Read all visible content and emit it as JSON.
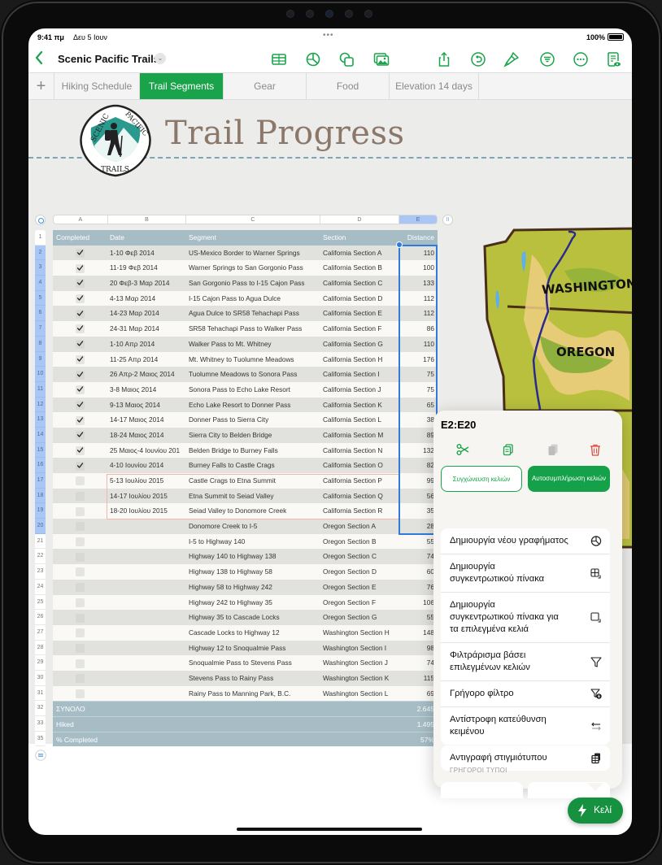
{
  "status_bar": {
    "time": "9:41 πμ",
    "date": "Δευ 5 Ιουν",
    "battery": "100%",
    "battery_level": 1.0
  },
  "toolbar": {
    "back_icon": "chevron-left-icon",
    "document_title": "Scenic Pacific Trails",
    "title_menu_icon": "chevron-down-icon",
    "icons": [
      "table-icon",
      "chart-icon",
      "shapes-icon",
      "media-icon",
      "share-icon",
      "undo-icon",
      "format-brush-icon",
      "organize-icon",
      "more-icon",
      "reader-view-icon"
    ]
  },
  "tabs": {
    "add_icon": "plus-icon",
    "items": [
      {
        "label": "Hiking Schedule",
        "active": false
      },
      {
        "label": "Trail Segments",
        "active": true
      },
      {
        "label": "Gear",
        "active": false
      },
      {
        "label": "Food",
        "active": false
      },
      {
        "label": "Elevation 14 days",
        "active": false
      }
    ]
  },
  "sheet": {
    "title": "Trail Progress",
    "logo": {
      "top_text_left": "SCENIC",
      "top_text_right": "PACIFIC",
      "bottom_text": "TRAILS"
    },
    "column_letters": [
      "A",
      "B",
      "C",
      "D",
      "E"
    ],
    "selected_column": "E",
    "row_numbers": [
      "1",
      "2",
      "3",
      "4",
      "5",
      "6",
      "7",
      "8",
      "9",
      "10",
      "11",
      "12",
      "13",
      "14",
      "15",
      "16",
      "17",
      "18",
      "19",
      "20",
      "21",
      "22",
      "23",
      "24",
      "25",
      "26",
      "27",
      "28",
      "29",
      "30",
      "31",
      "32",
      "33",
      "35"
    ],
    "selected_rows": "2-20",
    "table": {
      "headers": [
        "Completed",
        "Date",
        "Segment",
        "Section",
        "Distance"
      ],
      "rows": [
        {
          "completed": true,
          "date": "1-10 Φεβ 2014",
          "segment": "US-Mexico Border to Warner Springs",
          "section": "California Section A",
          "distance": "110"
        },
        {
          "completed": true,
          "date": "11-19 Φεβ 2014",
          "segment": "Warner Springs to San Gorgonio Pass",
          "section": "California Section B",
          "distance": "100"
        },
        {
          "completed": true,
          "date": "20 Φεβ-3 Μαρ 2014",
          "segment": "San Gorgonio Pass to I-15 Cajon Pass",
          "section": "California Section C",
          "distance": "133"
        },
        {
          "completed": true,
          "date": "4-13 Μαρ 2014",
          "segment": "I-15 Cajon Pass to Agua Dulce",
          "section": "California Section D",
          "distance": "112"
        },
        {
          "completed": true,
          "date": "14-23 Μαρ 2014",
          "segment": "Agua Dulce to SR58 Tehachapi Pass",
          "section": "California Section E",
          "distance": "112"
        },
        {
          "completed": true,
          "date": "24-31 Μαρ 2014",
          "segment": "SR58 Tehachapi Pass to Walker Pass",
          "section": "California Section F",
          "distance": "86"
        },
        {
          "completed": true,
          "date": "1-10 Απρ 2014",
          "segment": "Walker Pass to Mt. Whitney",
          "section": "California Section G",
          "distance": "110"
        },
        {
          "completed": true,
          "date": "11-25 Απρ 2014",
          "segment": "Mt. Whitney to Tuolumne Meadows",
          "section": "California Section H",
          "distance": "176"
        },
        {
          "completed": true,
          "date": "26 Απρ-2 Μαιος 2014",
          "segment": "Tuolumne Meadows to Sonora Pass",
          "section": "California Section I",
          "distance": "75"
        },
        {
          "completed": true,
          "date": "3-8 Μαιος 2014",
          "segment": "Sonora Pass to Echo Lake Resort",
          "section": "California Section J",
          "distance": "75"
        },
        {
          "completed": true,
          "date": "9-13 Μαιος 2014",
          "segment": "Echo Lake Resort to Donner Pass",
          "section": "California Section K",
          "distance": "65"
        },
        {
          "completed": true,
          "date": "14-17 Μαιος 2014",
          "segment": "Donner Pass to Sierra City",
          "section": "California Section L",
          "distance": "38"
        },
        {
          "completed": true,
          "date": "18-24 Μαιος 2014",
          "segment": "Sierra City to Belden Bridge",
          "section": "California Section M",
          "distance": "89"
        },
        {
          "completed": true,
          "date": "25 Μαιος-4 Ιουνίου 201",
          "segment": "Belden Bridge to Burney Falls",
          "section": "California Section N",
          "distance": "132"
        },
        {
          "completed": true,
          "date": "4-10 Ιουνίου 2014",
          "segment": "Burney Falls to Castle Crags",
          "section": "California Section O",
          "distance": "82"
        },
        {
          "completed": false,
          "date": "5-13 Ιουλίου 2015",
          "segment": "Castle Crags to Etna Summit",
          "section": "California Section P",
          "distance": "99"
        },
        {
          "completed": false,
          "date": "14-17 Ιουλίου 2015",
          "segment": "Etna Summit to Seiad Valley",
          "section": "California Section Q",
          "distance": "56"
        },
        {
          "completed": false,
          "date": "18-20 Ιουλίου 2015",
          "segment": "Seiad Valley to Donomore Creek",
          "section": "California Section R",
          "distance": "35"
        },
        {
          "completed": false,
          "date": "",
          "segment": "Donomore Creek to I-5",
          "section": "Oregon Section A",
          "distance": "28"
        },
        {
          "completed": false,
          "date": "",
          "segment": "I-5 to Highway 140",
          "section": "Oregon Section B",
          "distance": "55"
        },
        {
          "completed": false,
          "date": "",
          "segment": "Highway 140 to Highway 138",
          "section": "Oregon Section C",
          "distance": "74"
        },
        {
          "completed": false,
          "date": "",
          "segment": "Highway 138 to Highway 58",
          "section": "Oregon Section D",
          "distance": "60"
        },
        {
          "completed": false,
          "date": "",
          "segment": "Highway 58 to Highway 242",
          "section": "Oregon Section E",
          "distance": "76"
        },
        {
          "completed": false,
          "date": "",
          "segment": "Highway 242 to Highway 35",
          "section": "Oregon Section F",
          "distance": "106"
        },
        {
          "completed": false,
          "date": "",
          "segment": "Highway 35 to Cascade Locks",
          "section": "Oregon Section G",
          "distance": "55"
        },
        {
          "completed": false,
          "date": "",
          "segment": "Cascade Locks to Highway 12",
          "section": "Washington Section H",
          "distance": "148"
        },
        {
          "completed": false,
          "date": "",
          "segment": "Highway 12 to Snoqualmie Pass",
          "section": "Washington Section I",
          "distance": "98"
        },
        {
          "completed": false,
          "date": "",
          "segment": "Snoqualmie Pass to Stevens Pass",
          "section": "Washington Section J",
          "distance": "74"
        },
        {
          "completed": false,
          "date": "",
          "segment": "Stevens Pass to Rainy Pass",
          "section": "Washington Section K",
          "distance": "115"
        },
        {
          "completed": false,
          "date": "",
          "segment": "Rainy Pass to Manning Park, B.C.",
          "section": "Washington Section L",
          "distance": "69"
        }
      ],
      "footer": [
        {
          "label": "ΣΥΝΟΛΟ",
          "value": "2.645"
        },
        {
          "label": "Hiked",
          "value": "1.495"
        },
        {
          "label": "% Completed",
          "value": "57%"
        }
      ]
    }
  },
  "map": {
    "labels": [
      "WASHINGTON",
      "OREGON"
    ],
    "colors": {
      "land": "#b5bf3a",
      "route": "#2a2a8f",
      "highlight": "#e0452a"
    }
  },
  "popover": {
    "title": "E2:E20",
    "actions": [
      {
        "icon": "scissors-icon",
        "label": "Cut",
        "enabled": true
      },
      {
        "icon": "copy-icon",
        "label": "Copy",
        "enabled": true
      },
      {
        "icon": "paste-icon",
        "label": "Paste",
        "enabled": false
      },
      {
        "icon": "trash-icon",
        "label": "Delete",
        "enabled": true
      }
    ],
    "merge_button": "Συγχώνευση κελιών",
    "autofill_button": "Αυτοσυμπλήρωση κελιών",
    "menu_items": [
      {
        "label": "Δημιουργία νέου γραφήματος",
        "icon": "chart-icon"
      },
      {
        "label": "Δημιουργία συγκεντρωτικού πίνακα",
        "icon": "pivot-table-icon"
      },
      {
        "label": "Δημιουργία συγκεντρωτικού πίνακα για τα επιλεγμένα κελιά",
        "icon": "pivot-selection-icon"
      },
      {
        "label": "Φιλτράρισμα βάσει επιλεγμένων κελιών",
        "icon": "filter-icon"
      },
      {
        "label": "Γρήγορο φίλτρο",
        "icon": "quick-filter-icon"
      },
      {
        "label": "Αντίστροφη κατεύθυνση κειμένου",
        "icon": "text-direction-icon"
      }
    ],
    "snapshot_item": {
      "label": "Αντιγραφή στιγμιότυπου",
      "icon": "snapshot-icon"
    },
    "quick_formulas_label": "ΓΡΗΓΟΡΟΙ ΤΥΠΟΙ"
  },
  "cell_button": {
    "label": "Κελί",
    "icon": "bolt-icon"
  },
  "colors": {
    "accent": "#1aa34a",
    "selection": "#2f7bdb",
    "table_header": "#a6bdc6",
    "title": "#8b786a",
    "delete": "#e5473a"
  }
}
